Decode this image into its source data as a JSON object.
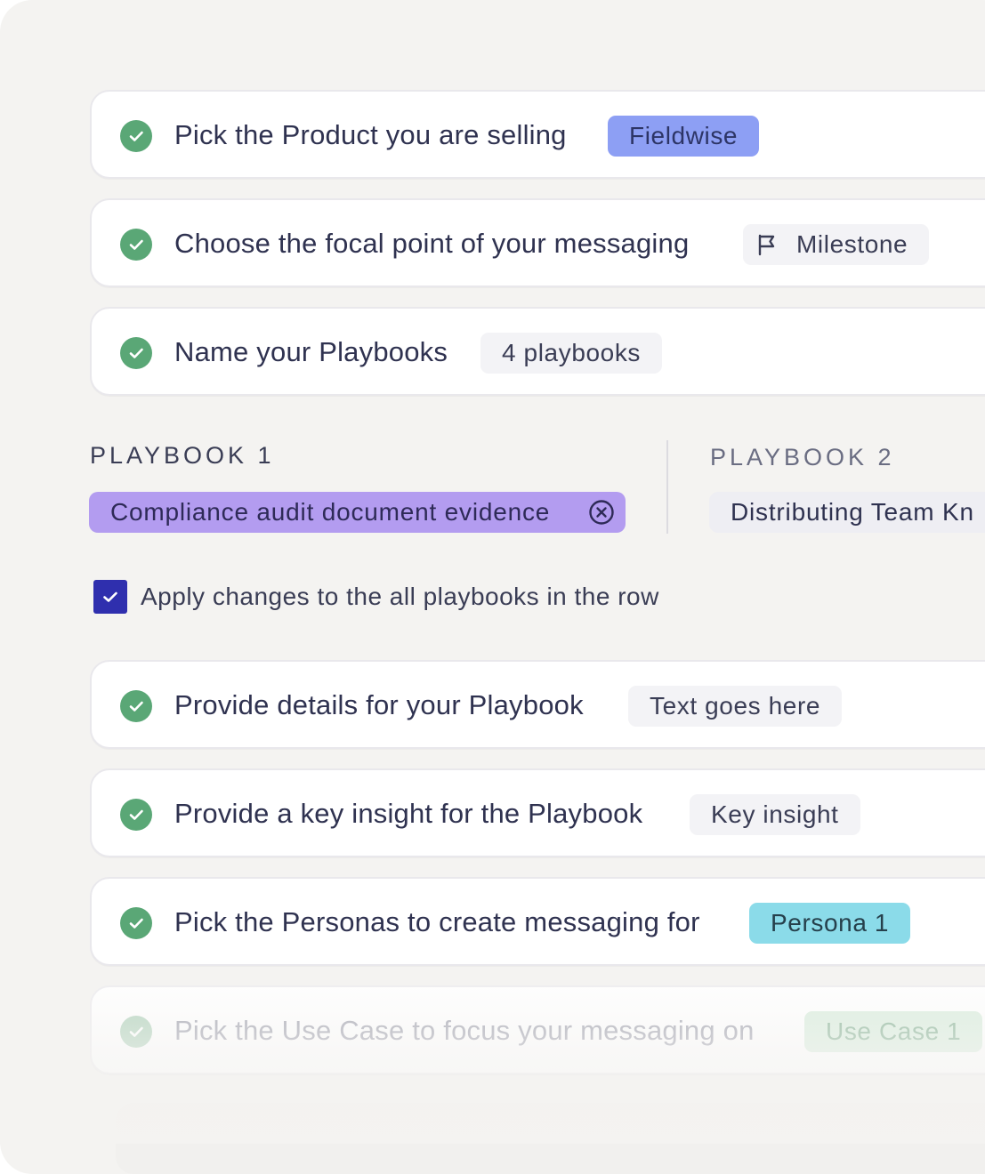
{
  "steps": [
    {
      "label": "Pick the Product you are selling",
      "chip": "Fieldwise"
    },
    {
      "label": "Choose the focal point of your messaging",
      "chip": "Milestone",
      "chip_icon": "flag-icon"
    },
    {
      "label": "Name your Playbooks",
      "chip": "4 playbooks"
    },
    {
      "label": "Provide details for your Playbook",
      "chip": "Text goes here"
    },
    {
      "label": "Provide a key insight for the Playbook",
      "chip": "Key insight"
    },
    {
      "label": "Pick the Personas to create messaging for",
      "chip": "Persona 1"
    },
    {
      "label": "Pick the Use Case to focus your messaging on",
      "chip": "Use Case 1"
    }
  ],
  "playbooks": [
    {
      "heading": "PLAYBOOK 1",
      "value": "Compliance audit document evidence",
      "chip_icon": "clear-icon"
    },
    {
      "heading": "PLAYBOOK 2",
      "value": "Distributing Team Kn"
    }
  ],
  "apply_all": {
    "label": "Apply changes to the all playbooks in the row",
    "checked": true
  },
  "colors": {
    "check_green": "#5aa776",
    "product_chip": "#8d9ff4",
    "playbook_chip": "#b39cf0",
    "persona_chip": "#8bdbe9",
    "use_case_chip": "#dcefe0",
    "checkbox": "#2f2fae",
    "text": "#2f3250"
  }
}
